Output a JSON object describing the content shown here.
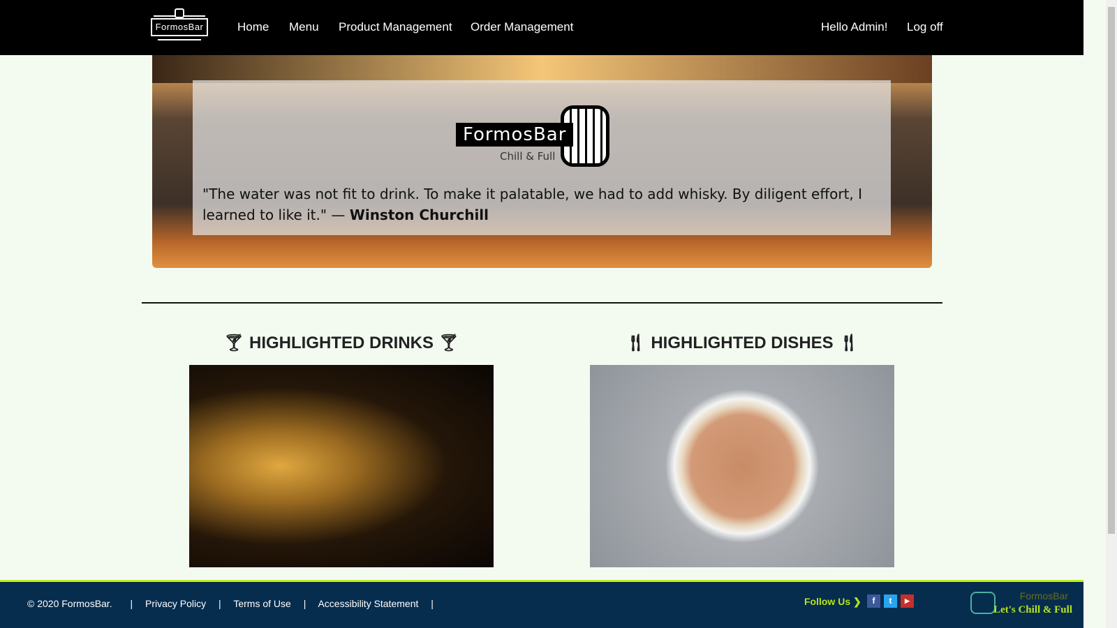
{
  "nav": {
    "logo_text": "FormosBar",
    "links": [
      "Home",
      "Menu",
      "Product Management",
      "Order Management"
    ],
    "greeting": "Hello Admin!",
    "logoff": "Log off"
  },
  "hero": {
    "brand": "FormosBar",
    "tagline": "Chill & Full",
    "quote": "\"The water was not fit to drink. To make it palatable, we had to add whisky. By diligent effort, I learned to like it.\" — ",
    "author": "Winston Churchill"
  },
  "sections": {
    "drinks": "HIGHLIGHTED DRINKS",
    "dishes": "HIGHLIGHTED DISHES"
  },
  "footer": {
    "copyright": "© 2020 FormosBar.",
    "links": [
      "Privacy Policy",
      "Terms of Use",
      "Accessibility Statement"
    ],
    "sep": "|",
    "follow": "Follow Us",
    "brand": "FormosBar",
    "slogan": "Let's Chill & Full"
  }
}
